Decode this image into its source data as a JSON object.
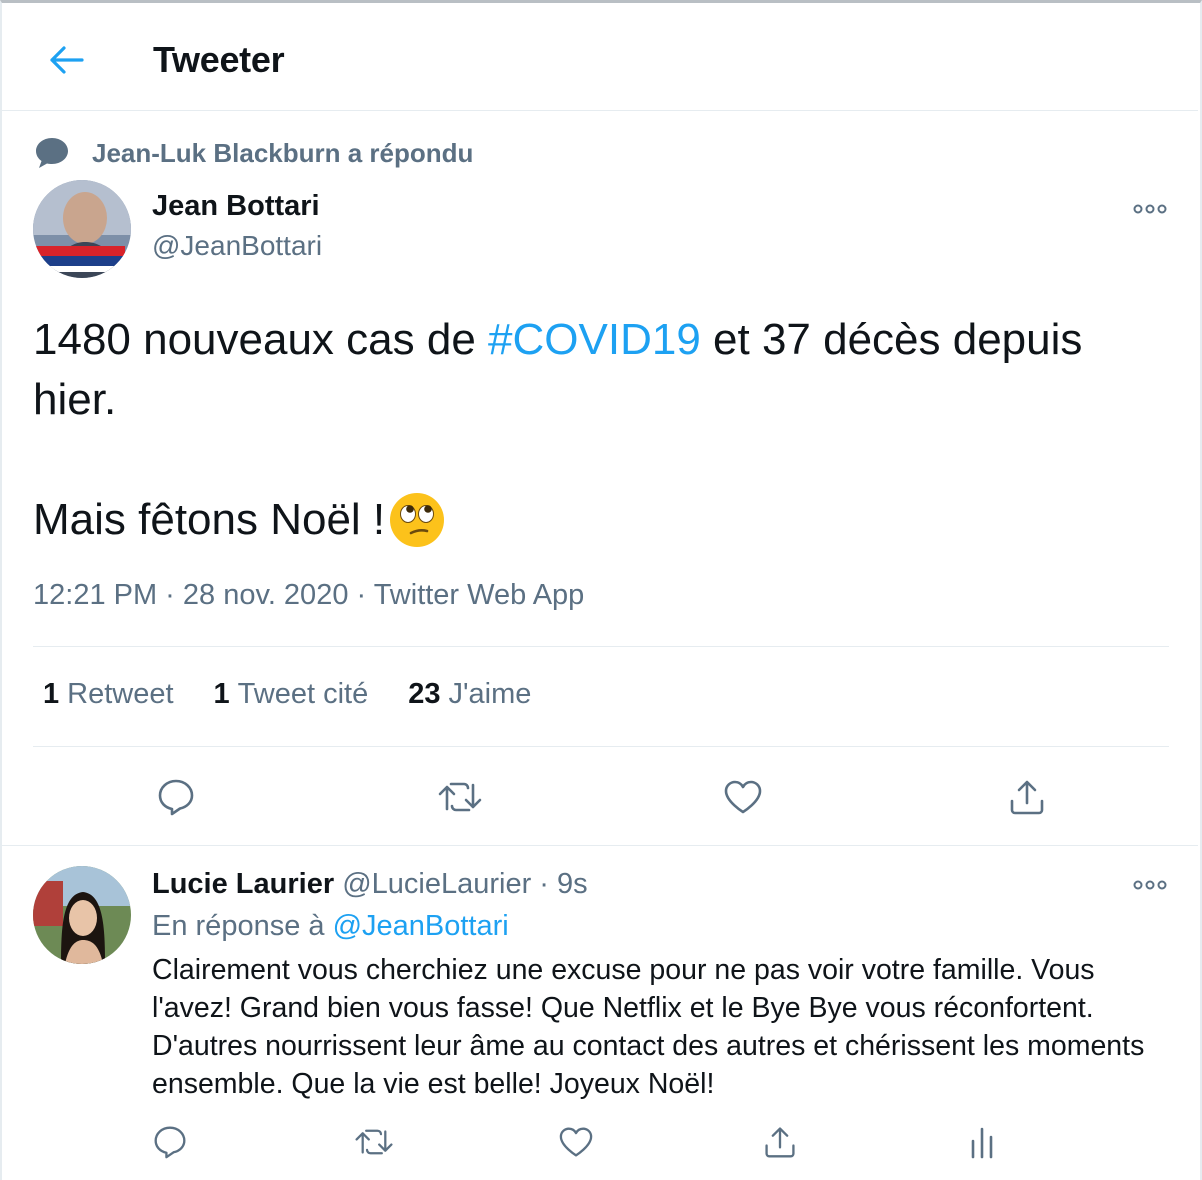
{
  "header": {
    "title": "Tweeter",
    "back_icon": "arrow-left-icon",
    "accent": "#1da1f2"
  },
  "context": {
    "text": "Jean-Luk Blackburn a répondu",
    "icon": "speech-bubble-icon"
  },
  "tweet": {
    "author_name": "Jean Bottari",
    "author_handle": "@JeanBottari",
    "text_before": "1480 nouveaux cas de ",
    "hashtag": "#COVID19",
    "text_after": " et 37 décès depuis hier.",
    "text_line2": "Mais fêtons Noël !",
    "emoji": "face-with-rolling-eyes",
    "meta": "12:21 PM · 28 nov. 2020 · Twitter Web App",
    "stats": [
      {
        "count": "1",
        "label": "Retweet"
      },
      {
        "count": "1",
        "label": "Tweet cité"
      },
      {
        "count": "23",
        "label": "J'aime"
      }
    ],
    "actions": [
      "reply-icon",
      "retweet-icon",
      "like-icon",
      "share-icon"
    ]
  },
  "reply": {
    "author_name": "Lucie Laurier",
    "author_handle": "@LucieLaurier",
    "time": "· 9s",
    "reply_to_label": "En réponse à ",
    "reply_to_handle": "@JeanBottari",
    "text": "Clairement vous cherchiez une excuse pour ne pas voir votre famille. Vous l'avez! Grand bien vous fasse! Que Netflix et le Bye Bye vous réconfortent. D'autres nourrissent leur âme au contact des autres et chérissent les moments ensemble. Que la vie est belle! Joyeux Noël!",
    "actions": [
      "reply-icon",
      "retweet-icon",
      "like-icon",
      "share-icon",
      "analytics-icon"
    ]
  }
}
